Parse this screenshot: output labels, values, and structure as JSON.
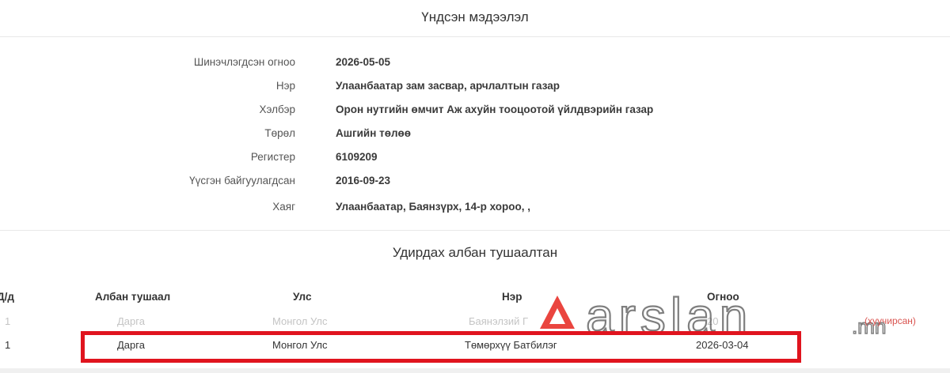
{
  "sections": {
    "basic_info_title": "Үндсэн мэдээлэл",
    "officials_title": "Удирдах албан тушаалтан"
  },
  "info": [
    {
      "label": "Шинэчлэгдсэн огноо",
      "value": "2026-05-05"
    },
    {
      "label": "Нэр",
      "value": "Улаанбаатар зам засвар, арчлалтын газар"
    },
    {
      "label": "Хэлбэр",
      "value": "Орон нутгийн өмчит Аж ахуйн тооцоотой үйлдвэрийн газар"
    },
    {
      "label": "Төрөл",
      "value": "Ашгийн төлөө"
    },
    {
      "label": "Регистер",
      "value": "6109209"
    },
    {
      "label": "Үүсгэн байгуулагдсан",
      "value": "2016-09-23"
    },
    {
      "label": "Хаяг",
      "value": "Улаанбаатар, Баянзүрх, 14-р хороо, ,"
    }
  ],
  "table": {
    "headers": {
      "no": "Д/д",
      "position": "Албан тушаал",
      "country": "Улс",
      "name": "Нэр",
      "date": "Огноо"
    },
    "rows": [
      {
        "no": "1",
        "position": "Дарга",
        "country": "Монгол Улс",
        "name": "Баянэлзий Г",
        "date": "20",
        "action": "(хуучирсан)"
      },
      {
        "no": "1",
        "position": "Дарга",
        "country": "Монгол Улс",
        "name": "Төмөрхүү Батбилэг",
        "date": "2026-03-04"
      }
    ]
  },
  "watermark": {
    "text": "arslan.mn",
    "color": "#e8312a"
  },
  "colors": {
    "highlight": "#e0141e"
  }
}
